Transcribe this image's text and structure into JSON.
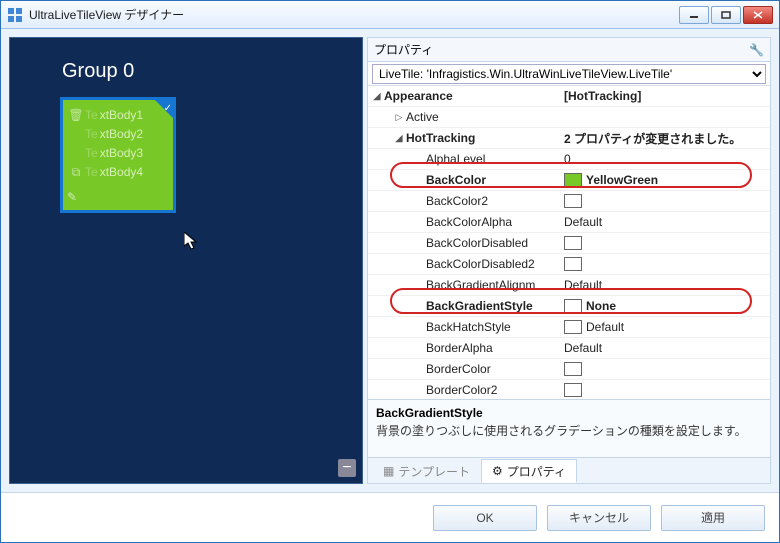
{
  "window": {
    "title": "UltraLiveTileView デザイナー"
  },
  "design": {
    "group_title": "Group 0",
    "tile_lines": [
      "xtBody1",
      "xtBody2",
      "xtBody3",
      "xtBody4"
    ]
  },
  "props": {
    "panel_title": "プロパティ",
    "object_selector": "LiveTile: 'Infragistics.Win.UltraWinLiveTileView.LiveTile'",
    "rows": {
      "appearance": "Appearance",
      "appearance_val": "[HotTracking]",
      "active": "Active",
      "hottracking": "HotTracking",
      "hottracking_val": "2 プロパティが変更されました。",
      "alphalevel": "AlphaLevel",
      "alphalevel_val": "0",
      "backcolor": "BackColor",
      "backcolor_val": "YellowGreen",
      "backcolor2": "BackColor2",
      "backcoloralpha": "BackColorAlpha",
      "backcoloralpha_val": "Default",
      "backcolordisabled": "BackColorDisabled",
      "backcolordisabled2": "BackColorDisabled2",
      "backgradientalignm": "BackGradientAlignm",
      "backgradientalignm_val": "Default",
      "backgradientstyle": "BackGradientStyle",
      "backgradientstyle_val": "None",
      "backhatchstyle": "BackHatchStyle",
      "backhatchstyle_val": "Default",
      "borderalpha": "BorderAlpha",
      "borderalpha_val": "Default",
      "bordercolor": "BorderColor",
      "bordercolor2": "BorderColor2"
    },
    "desc_title": "BackGradientStyle",
    "desc_body": "背景の塗りつぶしに使用されるグラデーションの種類を設定します。",
    "tabs": {
      "template": "テンプレート",
      "properties": "プロパティ"
    }
  },
  "buttons": {
    "ok": "OK",
    "cancel": "キャンセル",
    "apply": "適用"
  }
}
